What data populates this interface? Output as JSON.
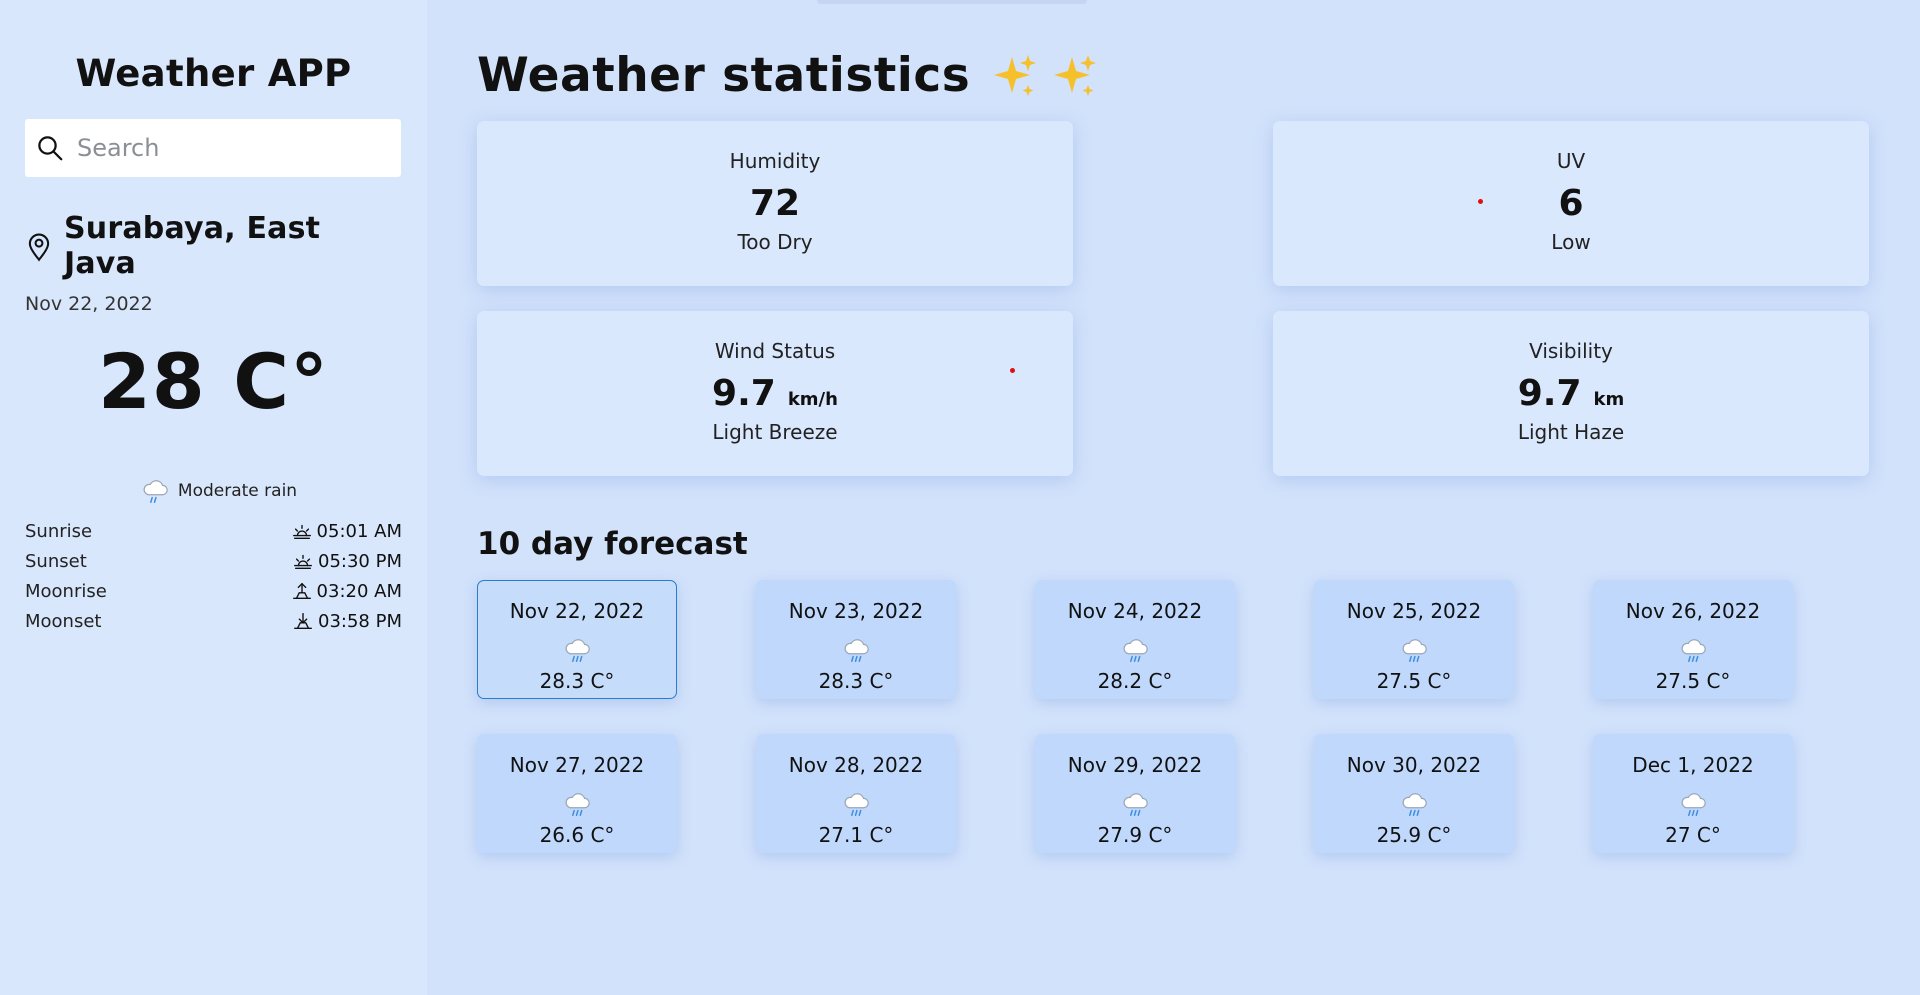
{
  "sidebar": {
    "title": "Weather APP",
    "search_placeholder": "Search",
    "location": "Surabaya, East Java",
    "date": "Nov 22, 2022",
    "temperature": "28 C°",
    "condition": "Moderate rain",
    "astro": [
      {
        "label": "Sunrise",
        "value": "05:01 AM",
        "icon": "sunrise-icon"
      },
      {
        "label": "Sunset",
        "value": "05:30 PM",
        "icon": "sunset-icon"
      },
      {
        "label": "Moonrise",
        "value": "03:20 AM",
        "icon": "moonrise-icon"
      },
      {
        "label": "Moonset",
        "value": "03:58 PM",
        "icon": "moonset-icon"
      }
    ]
  },
  "main": {
    "title": "Weather statistics",
    "title_icons": [
      "sparkles-icon",
      "sparkles-icon"
    ],
    "stats": {
      "humidity": {
        "label": "Humidity",
        "value": "72",
        "unit": "",
        "desc": "Too Dry"
      },
      "uv": {
        "label": "UV",
        "value": "6",
        "unit": "",
        "desc": "Low"
      },
      "wind": {
        "label": "Wind Status",
        "value": "9.7",
        "unit": "km/h",
        "desc": "Light Breeze"
      },
      "visibility": {
        "label": "Visibility",
        "value": "9.7",
        "unit": "km",
        "desc": "Light Haze"
      }
    },
    "forecast_title": "10 day forecast",
    "forecast": [
      {
        "date": "Nov 22, 2022",
        "temp": "28.3 C°",
        "active": true
      },
      {
        "date": "Nov 23, 2022",
        "temp": "28.3 C°"
      },
      {
        "date": "Nov 24, 2022",
        "temp": "28.2 C°"
      },
      {
        "date": "Nov 25, 2022",
        "temp": "27.5 C°"
      },
      {
        "date": "Nov 26, 2022",
        "temp": "27.5 C°"
      },
      {
        "date": "Nov 27, 2022",
        "temp": "26.6 C°"
      },
      {
        "date": "Nov 28, 2022",
        "temp": "27.1 C°"
      },
      {
        "date": "Nov 29, 2022",
        "temp": "27.9 C°"
      },
      {
        "date": "Nov 30, 2022",
        "temp": "25.9 C°"
      },
      {
        "date": "Dec 1, 2022",
        "temp": "27 C°"
      }
    ]
  },
  "colors": {
    "sidebar_bg": "#d9e7fc",
    "main_bg": "#d2e2fb",
    "card_bg": "#dae8fd",
    "forecast_card_bg": "#bfd8fb",
    "active_border": "#2a7dc6",
    "sparkle": "#f5c02a"
  }
}
